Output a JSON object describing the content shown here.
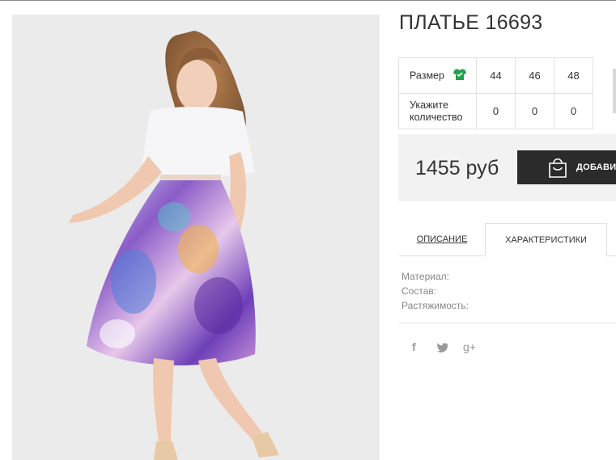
{
  "product": {
    "title": "ПЛАТЬЕ 16693",
    "image_alt": "Model wearing white top with purple floral skirt"
  },
  "sizes": {
    "size_label": "Размер",
    "quantity_label_line1": "Укажите",
    "quantity_label_line2": "количество",
    "size_icon": "shirt-icon",
    "columns": [
      {
        "size": "44",
        "qty": "0"
      },
      {
        "size": "46",
        "qty": "0"
      },
      {
        "size": "48",
        "qty": "0"
      }
    ]
  },
  "purchase": {
    "price": "1455 руб",
    "add_label": "ДОБАВИТ",
    "add_icon": "shopping-bag-icon"
  },
  "tabs": {
    "description": "ОПИСАНИЕ",
    "characteristics": "ХАРАКТЕРИСТИКИ"
  },
  "specs": {
    "material": "Материал:",
    "composition": "Состав:",
    "stretch": "Растяжимость:"
  },
  "social": {
    "facebook": "f",
    "twitter": "twitter-icon",
    "googleplus": "g+"
  },
  "colors": {
    "accent": "#2b2b2b",
    "shirt_icon": "#22a04b",
    "price_bg": "#f2f2f2"
  }
}
